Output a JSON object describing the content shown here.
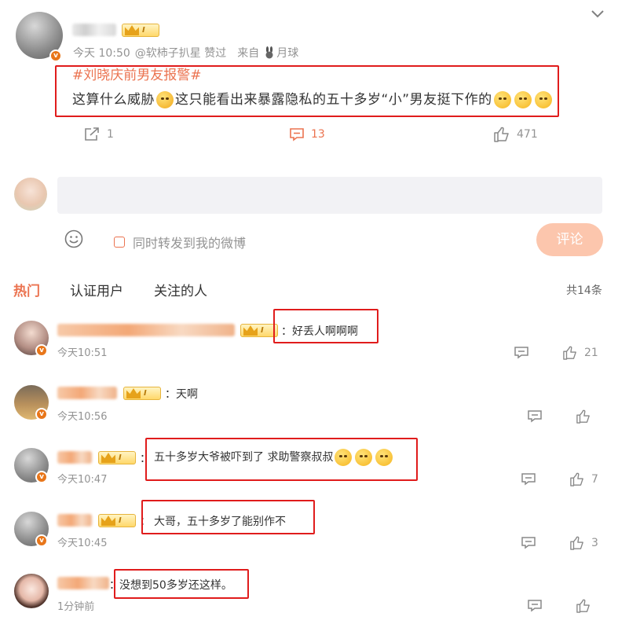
{
  "post": {
    "time": "今天 10:50",
    "via": "@软柿子扒星 赞过",
    "source_prefix": "来自",
    "source": "月球",
    "hashtag": "#刘晓庆前男友报警#",
    "text_a": "这算什么威胁",
    "text_b": "这只能看出来暴露隐私的五十多岁“小”男友挺下作的",
    "repost_count": "1",
    "comment_count": "13",
    "like_count": "471"
  },
  "composer": {
    "placeholder": "",
    "forward_label": "同时转发到我的微博",
    "submit_label": "评论"
  },
  "tabs": [
    {
      "label": "热门"
    },
    {
      "label": "认证用户"
    },
    {
      "label": "关注的人"
    }
  ],
  "total": "共14条",
  "comments": [
    {
      "text": "：好丢人啊啊啊",
      "time": "今天10:51",
      "likes": "21"
    },
    {
      "text": "：天啊",
      "time": "今天10:56",
      "likes": ""
    },
    {
      "text": "五十多岁大爷被吓到了 求助警察叔叔",
      "time": "今天10:47",
      "likes": "7"
    },
    {
      "text": "大哥，五十多岁了能别作不",
      "time": "今天10:45",
      "likes": "3"
    },
    {
      "text": "没想到50多岁还这样。",
      "time": "1分钟前",
      "likes": ""
    }
  ],
  "level_label": "I",
  "colors": {
    "accent": "#eb7350",
    "highlight_box": "#e01c1c"
  }
}
